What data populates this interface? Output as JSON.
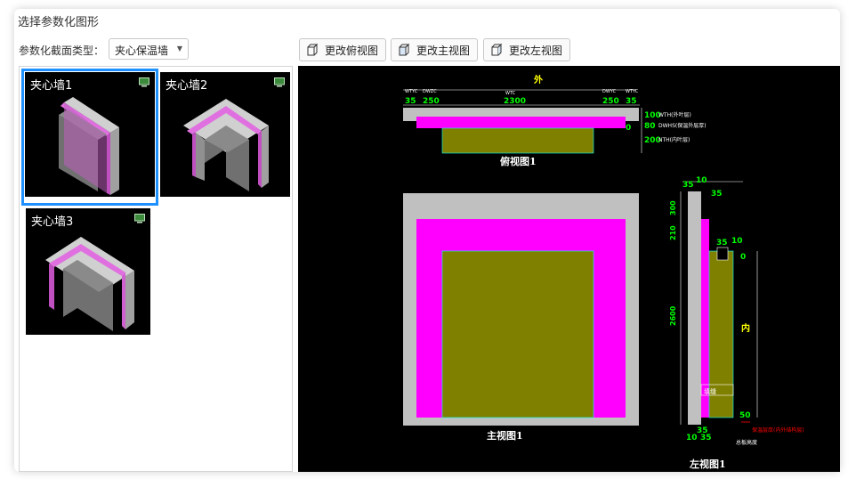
{
  "header": {
    "title": "选择参数化图形"
  },
  "toolbar": {
    "section_type_label": "参数化截面类型：",
    "section_type_value": "夹心保温墙",
    "buttons": [
      {
        "label": "更改俯视图"
      },
      {
        "label": "更改主视图"
      },
      {
        "label": "更改左视图"
      }
    ]
  },
  "gallery": {
    "items": [
      {
        "label": "夹心墙1",
        "selected": true
      },
      {
        "label": "夹心墙2",
        "selected": false
      },
      {
        "label": "夹心墙3",
        "selected": false
      }
    ]
  },
  "drawing": {
    "top_view": {
      "title": "俯视图1",
      "outside_label": "外",
      "dims_top": [
        "35",
        "250",
        "2300",
        "250",
        "35"
      ],
      "dim_codes_top": [
        "WTYC",
        "DWZC",
        "WTC",
        "DWYC",
        "WTYC"
      ],
      "dims_right": [
        "100",
        "80",
        "0",
        "200"
      ],
      "layer_labels": [
        "WTH(外叶层)",
        "DWHS(保温外层厚)",
        "NTH(内叶层)"
      ]
    },
    "front_view": {
      "title": "主视图1"
    },
    "left_view": {
      "title": "左视图1",
      "inside_label": "内",
      "dims_top": [
        "35",
        "10",
        "35"
      ],
      "dims_mid": [
        "35",
        "10",
        "0"
      ],
      "dims_left": [
        "300",
        "210",
        "2600"
      ],
      "dims_bottom": [
        "50",
        "35",
        "10",
        "35"
      ],
      "slot_label": "填缝",
      "red_note": "保温层厚(内外结构层)",
      "bottom_note": "总板高度"
    }
  },
  "colors": {
    "gray": "#c0c0c0",
    "magenta": "#ff00ff",
    "olive": "#808000",
    "dim_green": "#00ff00",
    "yellow": "#ffff00",
    "selection": "#1e90ff"
  }
}
